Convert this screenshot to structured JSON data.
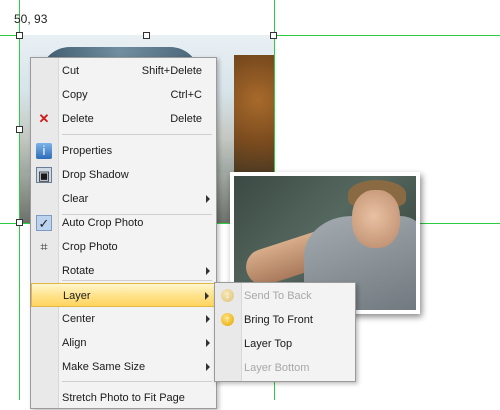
{
  "coordinates_text": "50, 93",
  "context_menu": {
    "items": [
      {
        "label": "Cut",
        "shortcut": "Shift+Delete",
        "icon": "",
        "submenu": false
      },
      {
        "label": "Copy",
        "shortcut": "Ctrl+C",
        "icon": "",
        "submenu": false
      },
      {
        "label": "Delete",
        "shortcut": "Delete",
        "icon": "delete-x-icon",
        "submenu": false
      },
      {
        "label": "Properties",
        "shortcut": "",
        "icon": "properties-icon",
        "submenu": false
      },
      {
        "label": "Drop Shadow",
        "shortcut": "",
        "icon": "drop-shadow-icon",
        "submenu": false
      },
      {
        "label": "Clear",
        "shortcut": "",
        "icon": "",
        "submenu": true
      },
      {
        "label": "Auto Crop Photo",
        "shortcut": "",
        "icon": "checkmark-icon",
        "submenu": false,
        "checked": true
      },
      {
        "label": "Crop Photo",
        "shortcut": "",
        "icon": "crop-icon",
        "submenu": false
      },
      {
        "label": "Rotate",
        "shortcut": "",
        "icon": "",
        "submenu": true
      },
      {
        "label": "Layer",
        "shortcut": "",
        "icon": "",
        "submenu": true,
        "highlighted": true
      },
      {
        "label": "Center",
        "shortcut": "",
        "icon": "",
        "submenu": true
      },
      {
        "label": "Align",
        "shortcut": "",
        "icon": "",
        "submenu": true
      },
      {
        "label": "Make Same Size",
        "shortcut": "",
        "icon": "",
        "submenu": true
      },
      {
        "label": "Stretch Photo to Fit Page",
        "shortcut": "",
        "icon": "",
        "submenu": false
      }
    ]
  },
  "layer_submenu": {
    "items": [
      {
        "label": "Send To Back",
        "enabled": false,
        "icon": "send-to-back-icon"
      },
      {
        "label": "Bring To Front",
        "enabled": true,
        "icon": "bring-to-front-icon"
      },
      {
        "label": "Layer Top",
        "enabled": true,
        "icon": ""
      },
      {
        "label": "Layer Bottom",
        "enabled": false,
        "icon": ""
      }
    ]
  },
  "colors": {
    "guide_lines": "#2ecc40",
    "highlight": "#ffd45e",
    "delete_icon": "#d01818"
  }
}
